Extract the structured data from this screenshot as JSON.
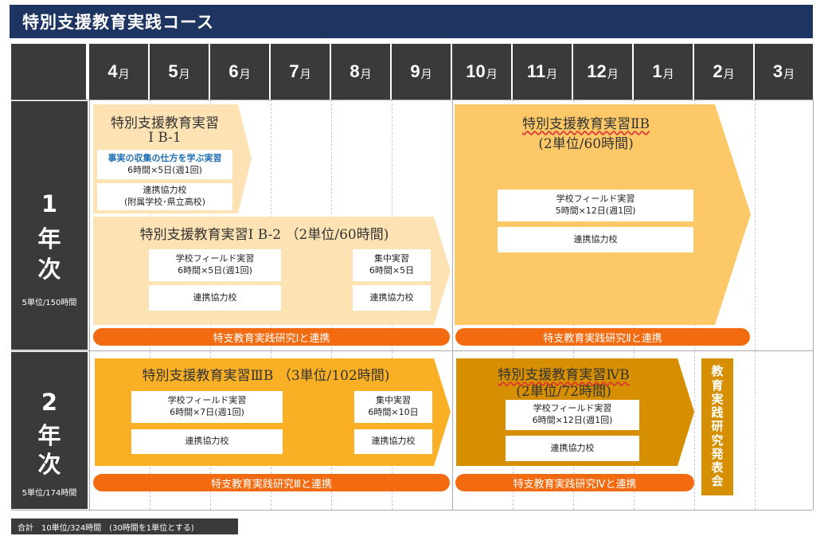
{
  "title": "特別支援教育実践コース",
  "months": [
    {
      "num": "4",
      "unit": "月"
    },
    {
      "num": "5",
      "unit": "月"
    },
    {
      "num": "6",
      "unit": "月"
    },
    {
      "num": "7",
      "unit": "月"
    },
    {
      "num": "8",
      "unit": "月"
    },
    {
      "num": "9",
      "unit": "月"
    },
    {
      "num": "10",
      "unit": "月"
    },
    {
      "num": "11",
      "unit": "月"
    },
    {
      "num": "12",
      "unit": "月"
    },
    {
      "num": "1",
      "unit": "月"
    },
    {
      "num": "2",
      "unit": "月"
    },
    {
      "num": "3",
      "unit": "月"
    }
  ],
  "year1": {
    "chars": [
      "1",
      "年",
      "次"
    ],
    "units": "5単位/150時間",
    "ib1": {
      "title_line1": "特別支援教育実習",
      "title_line2": "Ⅰ B-1",
      "box1_line1": "事実の収集の仕方を学ぶ実習",
      "box1_line2": "6時間×5日(週1回)",
      "box2_line1": "連携協力校",
      "box2_line2": "(附属学校･県立高校)"
    },
    "ib2": {
      "title": "特別支援教育実習Ⅰ B-2 （2単位/60時間)",
      "field_line1": "学校フィールド実習",
      "field_line2": "6時間×5日(週1回)",
      "partner": "連携協力校",
      "intensive_line1": "集中実習",
      "intensive_line2": "6時間×5日",
      "partner2": "連携協力校"
    },
    "iib": {
      "title_line1": "特別支援教育実習ⅡB",
      "title_line2": "(2単位/60時間)",
      "field_line1": "学校フィールド実習",
      "field_line2": "5時間×12日(週1回)",
      "partner": "連携協力校"
    },
    "bar1": "特支教育実践研究Ⅰと連携",
    "bar2": "特支教育実践研究Ⅱと連携"
  },
  "year2": {
    "chars": [
      "2",
      "年",
      "次"
    ],
    "units": "5単位/174時間",
    "iiib": {
      "title": "特別支援教育実習ⅢB （3単位/102時間)",
      "field_line1": "学校フィールド実習",
      "field_line2": "6時間×7日(週1回)",
      "partner": "連携協力校",
      "intensive_line1": "集中実習",
      "intensive_line2": "6時間×10日",
      "partner2": "連携協力校"
    },
    "ivb": {
      "title_line1": "特別支援教育実習ⅣB",
      "title_line2": "(2単位/72時間)",
      "field_line1": "学校フィールド実習",
      "field_line2": "6時間×12日(週1回)",
      "partner": "連携協力校"
    },
    "bar1": "特支教育実践研究Ⅲと連携",
    "bar2": "特支教育実践研究Ⅳと連携",
    "presentation": [
      "教",
      "育",
      "実",
      "践",
      "研",
      "究",
      "発",
      "表",
      "会"
    ]
  },
  "footer": "合計　10単位/324時間　(30時間を1単位とする)",
  "colors": {
    "title_bg": "#1e3461",
    "header_bg": "#3a3a3a",
    "light_peach": "#fde3b4",
    "mid_yellow": "#fdc867",
    "amber": "#f9b025",
    "dark_amber": "#d58f00",
    "orange_bar": "#f26b10"
  }
}
